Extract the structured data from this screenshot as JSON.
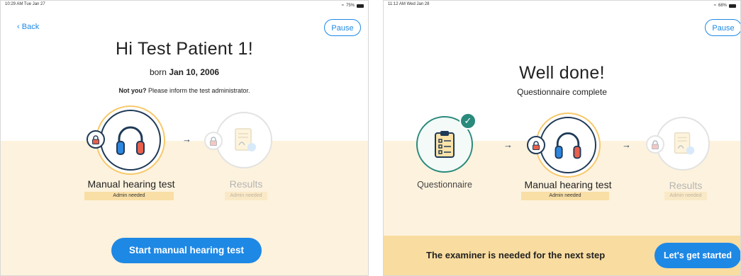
{
  "left": {
    "status": {
      "time": "10:29 AM  Tue Jan 27",
      "battery": "75%"
    },
    "back_label": "Back",
    "pause_label": "Pause",
    "greeting": "Hi Test Patient 1!",
    "born_prefix": "born",
    "born_date": "Jan 10, 2006",
    "not_you_bold": "Not you?",
    "not_you_rest": "Please inform the test administrator.",
    "steps": [
      {
        "label": "Manual hearing test",
        "tag": "Admin needed"
      },
      {
        "label": "Results",
        "tag": "Admin needed"
      }
    ],
    "start_button": "Start manual hearing test"
  },
  "right": {
    "status": {
      "time": "11:12 AM  Wed Jan 28",
      "battery": "68%"
    },
    "pause_label": "Pause",
    "title": "Well done!",
    "subtitle": "Questionnaire complete",
    "steps": [
      {
        "label": "Questionnaire"
      },
      {
        "label": "Manual hearing test",
        "tag": "Admin needed"
      },
      {
        "label": "Results",
        "tag": "Admin needed"
      }
    ],
    "banner_text": "The examiner is needed for the next step",
    "cta_button": "Let's get started"
  },
  "colors": {
    "accent_blue": "#1e88e5",
    "navy": "#1f3a57",
    "teal": "#2a8a7c",
    "cream": "#fdf2dd",
    "tag_yellow": "#f9dfa6",
    "ring_gold": "#f7c86a"
  },
  "icons": [
    "lock-icon",
    "headphones-icon",
    "results-doc-icon",
    "hand-pointer-icon",
    "clipboard-icon",
    "check-icon",
    "arrow-right-icon",
    "chevron-left-icon",
    "wifi-icon",
    "battery-icon"
  ]
}
